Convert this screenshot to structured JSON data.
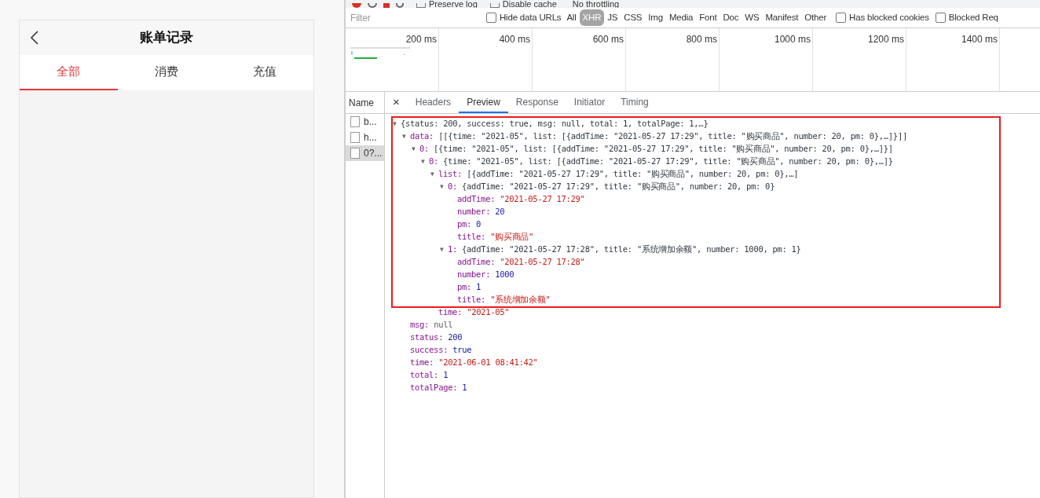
{
  "app": {
    "title": "账单记录",
    "tabs": [
      {
        "label": "全部",
        "selected": true
      },
      {
        "label": "消费",
        "selected": false
      },
      {
        "label": "充值",
        "selected": false
      }
    ]
  },
  "devtools": {
    "toolbar": [
      {
        "label": "Preserve log",
        "checked": false
      },
      {
        "label": "Disable cache",
        "checked": false
      }
    ],
    "throttling": "No throttling",
    "filter": {
      "placeholder": "Filter",
      "hide_data_urls": {
        "label": "Hide data URLs",
        "checked": false
      },
      "types": [
        {
          "label": "All",
          "selected": false
        },
        {
          "label": "XHR",
          "selected": true
        },
        {
          "label": "JS",
          "selected": false
        },
        {
          "label": "CSS",
          "selected": false
        },
        {
          "label": "Img",
          "selected": false
        },
        {
          "label": "Media",
          "selected": false
        },
        {
          "label": "Font",
          "selected": false
        },
        {
          "label": "Doc",
          "selected": false
        },
        {
          "label": "WS",
          "selected": false
        },
        {
          "label": "Manifest",
          "selected": false
        },
        {
          "label": "Other",
          "selected": false
        }
      ],
      "options": [
        {
          "label": "Has blocked cookies",
          "checked": false
        },
        {
          "label": "Blocked Req",
          "checked": false
        }
      ]
    },
    "timeline_ticks": [
      "200 ms",
      "400 ms",
      "600 ms",
      "800 ms",
      "1000 ms",
      "1200 ms",
      "1400 ms"
    ],
    "name_header": "Name",
    "requests": [
      {
        "name": "b...",
        "selected": false
      },
      {
        "name": "h...",
        "selected": false
      },
      {
        "name": "0?...",
        "selected": true
      }
    ],
    "close": "×",
    "detail_tabs": [
      {
        "label": "Headers",
        "selected": false
      },
      {
        "label": "Preview",
        "selected": true
      },
      {
        "label": "Response",
        "selected": false
      },
      {
        "label": "Initiator",
        "selected": false
      },
      {
        "label": "Timing",
        "selected": false
      }
    ],
    "preview": {
      "toggle": "▼",
      "preview": "{status: 200, success: true, msg: null, total: 1, totalPage: 1,…}",
      "expanded": true,
      "children": [
        {
          "toggle": "▼",
          "key": "data:",
          "preview": "[[{time: \"2021-05\", list: [{addTime: \"2021-05-27 17:29\", title: \"购买商品\", number: 20, pm: 0},…]}]]",
          "expanded": true,
          "children": [
            {
              "toggle": "▼",
              "key": "0:",
              "preview": "[{time: \"2021-05\", list: [{addTime: \"2021-05-27 17:29\", title: \"购买商品\", number: 20, pm: 0},…]}]",
              "expanded": true,
              "children": [
                {
                  "toggle": "▼",
                  "key": "0:",
                  "preview": "{time: \"2021-05\", list: [{addTime: \"2021-05-27 17:29\", title: \"购买商品\", number: 20, pm: 0},…]}",
                  "expanded": true,
                  "children": [
                    {
                      "toggle": "▼",
                      "key": "list:",
                      "preview": "[{addTime: \"2021-05-27 17:29\", title: \"购买商品\", number: 20, pm: 0},…]",
                      "expanded": true,
                      "children": [
                        {
                          "toggle": "▼",
                          "key": "0:",
                          "preview": "{addTime: \"2021-05-27 17:29\", title: \"购买商品\", number: 20, pm: 0}",
                          "expanded": true,
                          "children": [
                            {
                              "key": "addTime:",
                              "value": "\"2021-05-27 17:29\"",
                              "kind": "string"
                            },
                            {
                              "key": "number:",
                              "value": "20",
                              "kind": "number"
                            },
                            {
                              "key": "pm:",
                              "value": "0",
                              "kind": "number"
                            },
                            {
                              "key": "title:",
                              "value": "\"购买商品\"",
                              "kind": "string"
                            }
                          ]
                        },
                        {
                          "toggle": "▼",
                          "key": "1:",
                          "preview": "{addTime: \"2021-05-27 17:28\", title: \"系统增加余额\", number: 1000, pm: 1}",
                          "expanded": true,
                          "children": [
                            {
                              "key": "addTime:",
                              "value": "\"2021-05-27 17:28\"",
                              "kind": "string"
                            },
                            {
                              "key": "number:",
                              "value": "1000",
                              "kind": "number"
                            },
                            {
                              "key": "pm:",
                              "value": "1",
                              "kind": "number"
                            },
                            {
                              "key": "title:",
                              "value": "\"系统增加余额\"",
                              "kind": "string"
                            }
                          ]
                        }
                      ]
                    },
                    {
                      "key": "time:",
                      "value": "\"2021-05\"",
                      "kind": "string"
                    }
                  ]
                }
              ]
            }
          ]
        },
        {
          "key": "msg:",
          "value": "null",
          "kind": "null"
        },
        {
          "key": "status:",
          "value": "200",
          "kind": "number"
        },
        {
          "key": "success:",
          "value": "true",
          "kind": "boolean"
        },
        {
          "key": "time:",
          "value": "\"2021-06-01 08:41:42\"",
          "kind": "string"
        },
        {
          "key": "total:",
          "value": "1",
          "kind": "number"
        },
        {
          "key": "totalPage:",
          "value": "1",
          "kind": "number"
        }
      ]
    }
  }
}
